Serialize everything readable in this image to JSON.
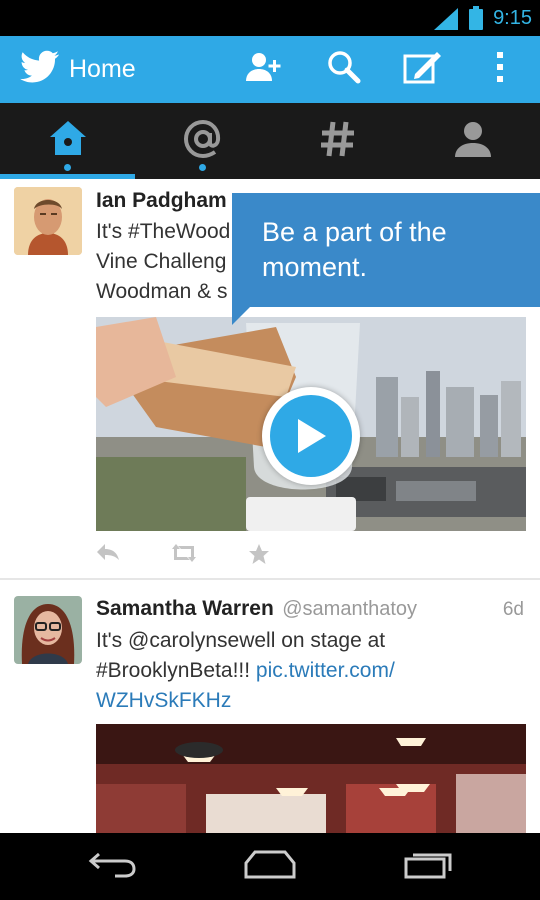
{
  "status_bar": {
    "time": "9:15",
    "signal_icon": "signal-icon",
    "battery_icon": "battery-icon"
  },
  "app_bar": {
    "title": "Home",
    "logo_icon": "twitter-bird-icon",
    "actions": [
      "add-user-icon",
      "search-icon",
      "compose-icon",
      "overflow-menu-icon"
    ],
    "color": "#2fa9e6"
  },
  "tabs": [
    {
      "name": "home",
      "icon": "home-icon",
      "selected": true,
      "has_dot": true
    },
    {
      "name": "connect",
      "icon": "at-icon",
      "selected": false,
      "has_dot": true
    },
    {
      "name": "discover",
      "icon": "hashtag-icon",
      "selected": false,
      "has_dot": false
    },
    {
      "name": "me",
      "icon": "person-icon",
      "selected": false,
      "has_dot": false
    }
  ],
  "callout": {
    "line1": "Be a part of the",
    "line2": "moment."
  },
  "tweets": [
    {
      "name": "Ian Padgham",
      "handle": "",
      "age": "",
      "lines": [
        "It's #TheWood",
        "Vine Challeng",
        "Woodman & s"
      ],
      "media": "vine-video"
    },
    {
      "name": "Samantha Warren",
      "handle": "@samanthatoy",
      "age": "6d",
      "line1_text": "It's @carolynsewell on stage at",
      "line2_text": "#BrooklynBeta!!! ",
      "line2_link": "pic.twitter.com/",
      "line3_link": "WZHvSkFKHz",
      "media": "photo"
    }
  ],
  "colors": {
    "accent": "#2fa9e6",
    "callout": "#3a89c9",
    "link": "#2b7bb9"
  }
}
